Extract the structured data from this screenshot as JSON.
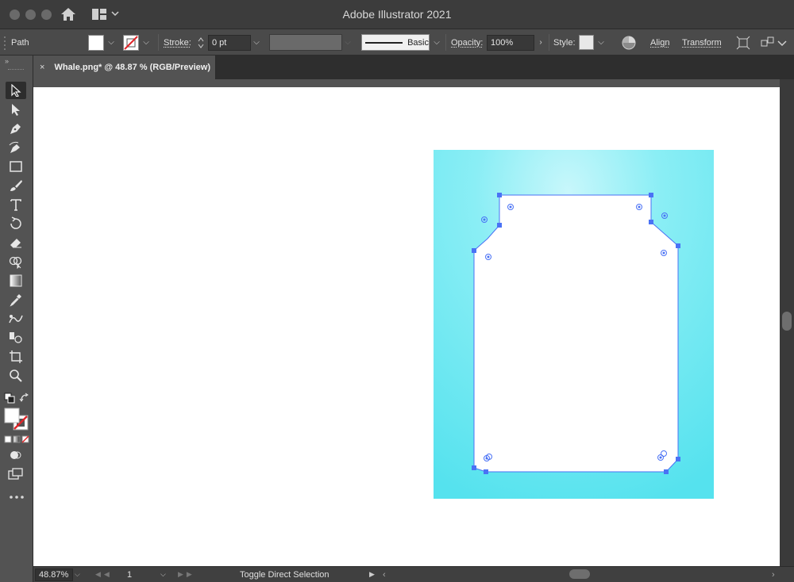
{
  "window": {
    "title": "Adobe Illustrator 2021"
  },
  "control_bar": {
    "selection_type": "Path",
    "stroke_label": "Stroke:",
    "stroke_weight": "0 pt",
    "brush_label": "Basic",
    "opacity_label": "Opacity:",
    "opacity_value": "100%",
    "style_label": "Style:",
    "align_label": "Align",
    "transform_label": "Transform"
  },
  "document_tab": {
    "close_glyph": "×",
    "title": "Whale.png* @ 48.87 % (RGB/Preview)"
  },
  "status_bar": {
    "zoom": "48.87%",
    "artboard_number": "1",
    "status_text": "Toggle Direct Selection"
  },
  "tools": [
    "selection-tool-icon",
    "direct-selection-tool-icon",
    "pen-tool-icon",
    "curvature-tool-icon",
    "rectangle-tool-icon",
    "paintbrush-tool-icon",
    "type-tool-icon",
    "rotate-tool-icon",
    "eraser-tool-icon",
    "shape-builder-tool-icon",
    "gradient-tool-icon",
    "eyedropper-tool-icon",
    "blend-tool-icon",
    "symbol-sprayer-tool-icon",
    "artboard-tool-icon",
    "zoom-tool-icon"
  ],
  "colors": {
    "ui_dark": "#323232",
    "ui_panel": "#535353",
    "artboard": "#ffffff",
    "image_background": "#5fe3ef",
    "selection_blue": "#4a72f5",
    "none_red": "#e0262a"
  }
}
